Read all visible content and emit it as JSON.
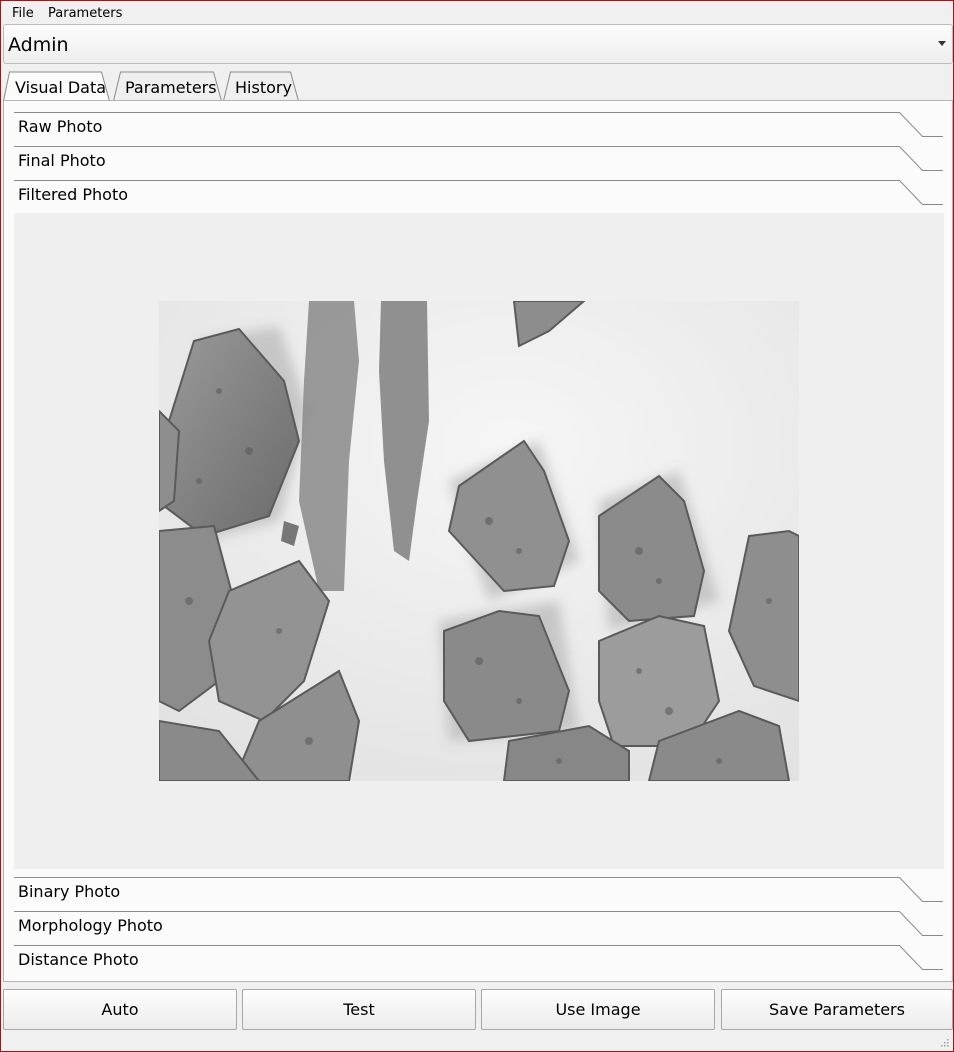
{
  "menu": {
    "file": "File",
    "parameters": "Parameters"
  },
  "user_select": {
    "value": "Admin"
  },
  "tabs": [
    {
      "label": "Visual Data",
      "active": true
    },
    {
      "label": "Parameters",
      "active": false
    },
    {
      "label": "History",
      "active": false
    }
  ],
  "sections": {
    "raw": "Raw Photo",
    "final": "Final Photo",
    "filtered": "Filtered Photo",
    "binary": "Binary Photo",
    "morphology": "Morphology Photo",
    "distance": "Distance Photo"
  },
  "buttons": {
    "auto": "Auto",
    "test": "Test",
    "use_image": "Use Image",
    "save_parameters": "Save Parameters"
  },
  "colors": {
    "window_border": "#a31515",
    "panel_bg": "#fbfbfb",
    "window_bg": "#f0f0f0"
  }
}
